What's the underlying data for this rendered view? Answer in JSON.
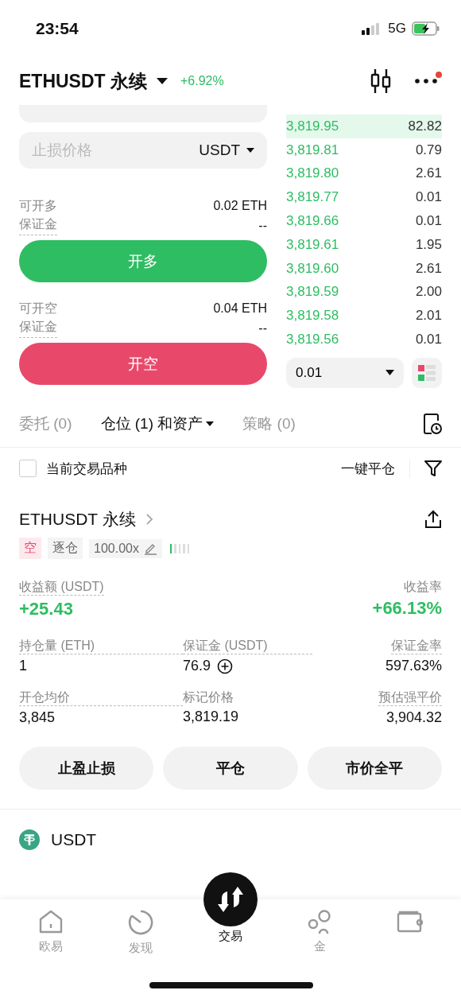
{
  "status_bar": {
    "time": "23:54",
    "network": "5G"
  },
  "header": {
    "symbol": "ETHUSDT 永续",
    "change": "+6.92%"
  },
  "order_form": {
    "stop_loss": {
      "placeholder": "止损价格",
      "unit": "USDT"
    },
    "sides": [
      {
        "kind": "long",
        "available_label": "可开多",
        "available": "0.02 ETH",
        "margin_label": "保证金",
        "margin": "--",
        "button": "开多"
      },
      {
        "kind": "short",
        "available_label": "可开空",
        "available": "0.04 ETH",
        "margin_label": "保证金",
        "margin": "--",
        "button": "开空"
      }
    ]
  },
  "order_book": {
    "rows": [
      {
        "price": "3,819.95",
        "amount": "82.82"
      },
      {
        "price": "3,819.81",
        "amount": "0.79"
      },
      {
        "price": "3,819.80",
        "amount": "2.61"
      },
      {
        "price": "3,819.77",
        "amount": "0.01"
      },
      {
        "price": "3,819.66",
        "amount": "0.01"
      },
      {
        "price": "3,819.61",
        "amount": "1.95"
      },
      {
        "price": "3,819.60",
        "amount": "2.61"
      },
      {
        "price": "3,819.59",
        "amount": "2.00"
      },
      {
        "price": "3,819.58",
        "amount": "2.01"
      },
      {
        "price": "3,819.56",
        "amount": "0.01"
      }
    ],
    "precision": "0.01"
  },
  "tabs": [
    {
      "label": "委托 (0)",
      "selected": false
    },
    {
      "label": "仓位 (1) 和资产",
      "selected": true,
      "dropdown": true
    },
    {
      "label": "策略 (0)",
      "selected": false
    }
  ],
  "filter": {
    "label": "当前交易品种",
    "checked": false,
    "close_all": "一键平仓"
  },
  "position": {
    "symbol": "ETHUSDT 永续",
    "side": "空",
    "margin_mode": "逐仓",
    "leverage": "100.00x",
    "level": 0.2,
    "pnl": {
      "label": "收益额 (USDT)",
      "value": "+25.43"
    },
    "roe": {
      "label": "收益率",
      "value": "+66.13%"
    },
    "stats": [
      {
        "label": "持仓量 (ETH)",
        "value": "1"
      },
      {
        "label": "保证金 (USDT)",
        "value": "76.9",
        "add": true
      },
      {
        "label": "保证金率",
        "value": "597.63%"
      },
      {
        "label": "开仓均价",
        "value": "3,845"
      },
      {
        "label": "标记价格",
        "value": "3,819.19"
      },
      {
        "label": "预估强平价",
        "value": "3,904.32"
      }
    ],
    "actions": [
      "止盈止损",
      "平仓",
      "市价全平"
    ]
  },
  "asset": {
    "name": "USDT"
  },
  "bottom_nav": [
    {
      "label": "欧易",
      "selected": false
    },
    {
      "label": "发现",
      "selected": false
    },
    {
      "label": "交易",
      "selected": true
    },
    {
      "label": "金",
      "selected": false
    },
    {
      "selected": false
    }
  ]
}
